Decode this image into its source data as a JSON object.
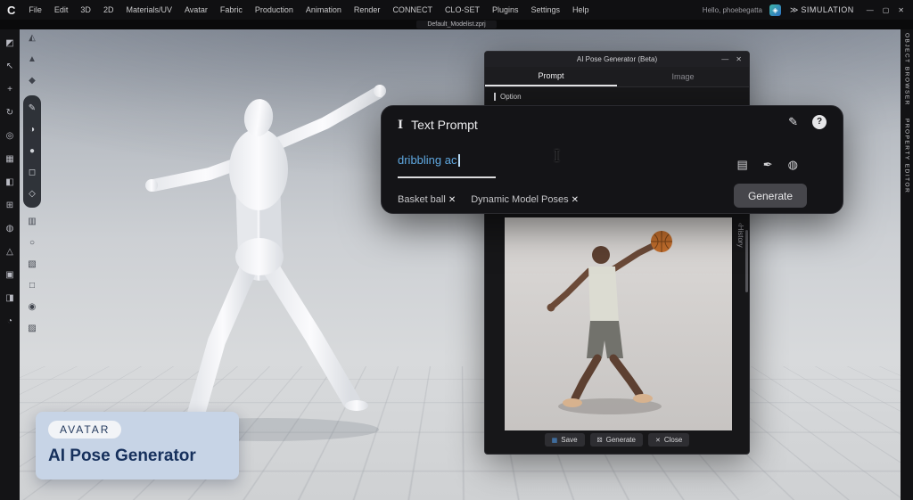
{
  "menubar": {
    "logo": "C",
    "items": [
      "File",
      "Edit",
      "3D",
      "2D",
      "Materials/UV",
      "Avatar",
      "Fabric",
      "Production",
      "Animation",
      "Render",
      "CONNECT",
      "CLO-SET",
      "Plugins",
      "Settings",
      "Help"
    ],
    "greeting": "Hello, phoebegatta",
    "simulation": "SIMULATION"
  },
  "tabbar": {
    "file_tab": "Default_Modelist.zprj"
  },
  "toolbar": {
    "col1": [
      "◩",
      "↖",
      "+",
      "↻",
      "◎",
      "▦",
      "◧",
      "⊞",
      "◍",
      "△",
      "▣",
      "◨",
      "◔"
    ],
    "col2": [
      "◭",
      "▲",
      "◆",
      "✎",
      "◑",
      "●",
      "◻",
      "◇",
      "▥",
      "○",
      "▧",
      "□",
      "◉",
      "▨"
    ]
  },
  "side": {
    "object_browser": "OBJECT BROWSER",
    "property_editor": "PROPERTY EDITOR"
  },
  "dialog": {
    "title": "AI Pose Generator (Beta)",
    "tab_prompt": "Prompt",
    "tab_image": "Image",
    "option": "Option",
    "history": "History",
    "save": "Save",
    "generate": "Generate",
    "close_btn": "Close"
  },
  "popup": {
    "title": "Text Prompt",
    "value": "dribbling ac",
    "generate": "Generate",
    "tags": [
      "Basket ball",
      "Dynamic Model Poses"
    ]
  },
  "card": {
    "badge": "AVATAR",
    "title": "AI Pose Generator"
  },
  "icons": {
    "minimize": "—",
    "maximize": "▢",
    "close": "✕",
    "chevrons": "≫",
    "caret": "I",
    "edit": "✎",
    "help": "?",
    "library": "▤",
    "pen": "✒",
    "sphere": "◍",
    "tag_close": "✕",
    "history_arrow": "‹",
    "save": "▦",
    "dice": "⚄",
    "badge": "◈",
    "cursor": "I"
  },
  "colors": {
    "accent_blue": "#5fa8e0",
    "card_bg": "#c7d4e6",
    "navy": "#16305c"
  }
}
